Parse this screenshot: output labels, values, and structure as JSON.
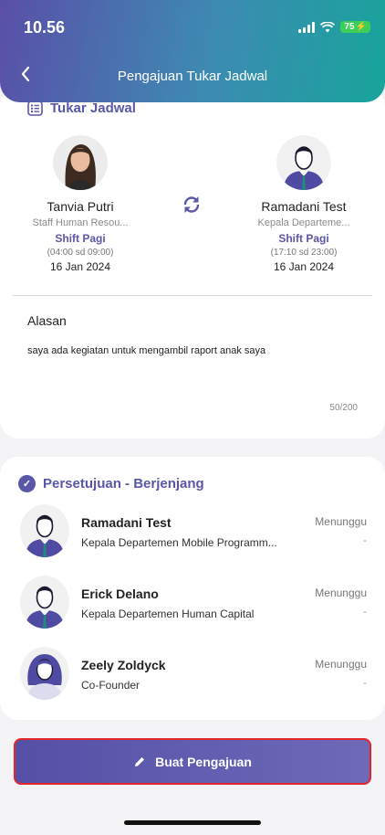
{
  "status_bar": {
    "time": "10.56",
    "battery": "75"
  },
  "header": {
    "title": "Pengajuan Tukar Jadwal"
  },
  "swap_section": {
    "title": "Tukar Jadwal",
    "requester": {
      "name": "Tanvia Putri",
      "role": "Staff Human Resou...",
      "shift": "Shift Pagi",
      "hours": "(04:00 sd 09:00)",
      "date": "16 Jan 2024"
    },
    "target": {
      "name": "Ramadani Test",
      "role": "Kepala Departeme...",
      "shift": "Shift Pagi",
      "hours": "(17:10 sd 23:00)",
      "date": "16 Jan 2024"
    },
    "reason_label": "Alasan",
    "reason_text": "saya ada kegiatan untuk mengambil raport anak saya",
    "char_count": "50/200"
  },
  "approval_section": {
    "title": "Persetujuan - Berjenjang",
    "approvers": [
      {
        "name": "Ramadani Test",
        "role": "Kepala Departemen Mobile Programm...",
        "status": "Menunggu",
        "time": "-"
      },
      {
        "name": "Erick Delano",
        "role": "Kepala Departemen Human Capital",
        "status": "Menunggu",
        "time": "-"
      },
      {
        "name": "Zeely Zoldyck",
        "role": "Co-Founder",
        "status": "Menunggu",
        "time": "-"
      }
    ]
  },
  "submit": {
    "label": "Buat Pengajuan"
  },
  "colors": {
    "accent": "#5b57a8",
    "submit_border": "#e2262b",
    "header_end": "#17a49a"
  }
}
